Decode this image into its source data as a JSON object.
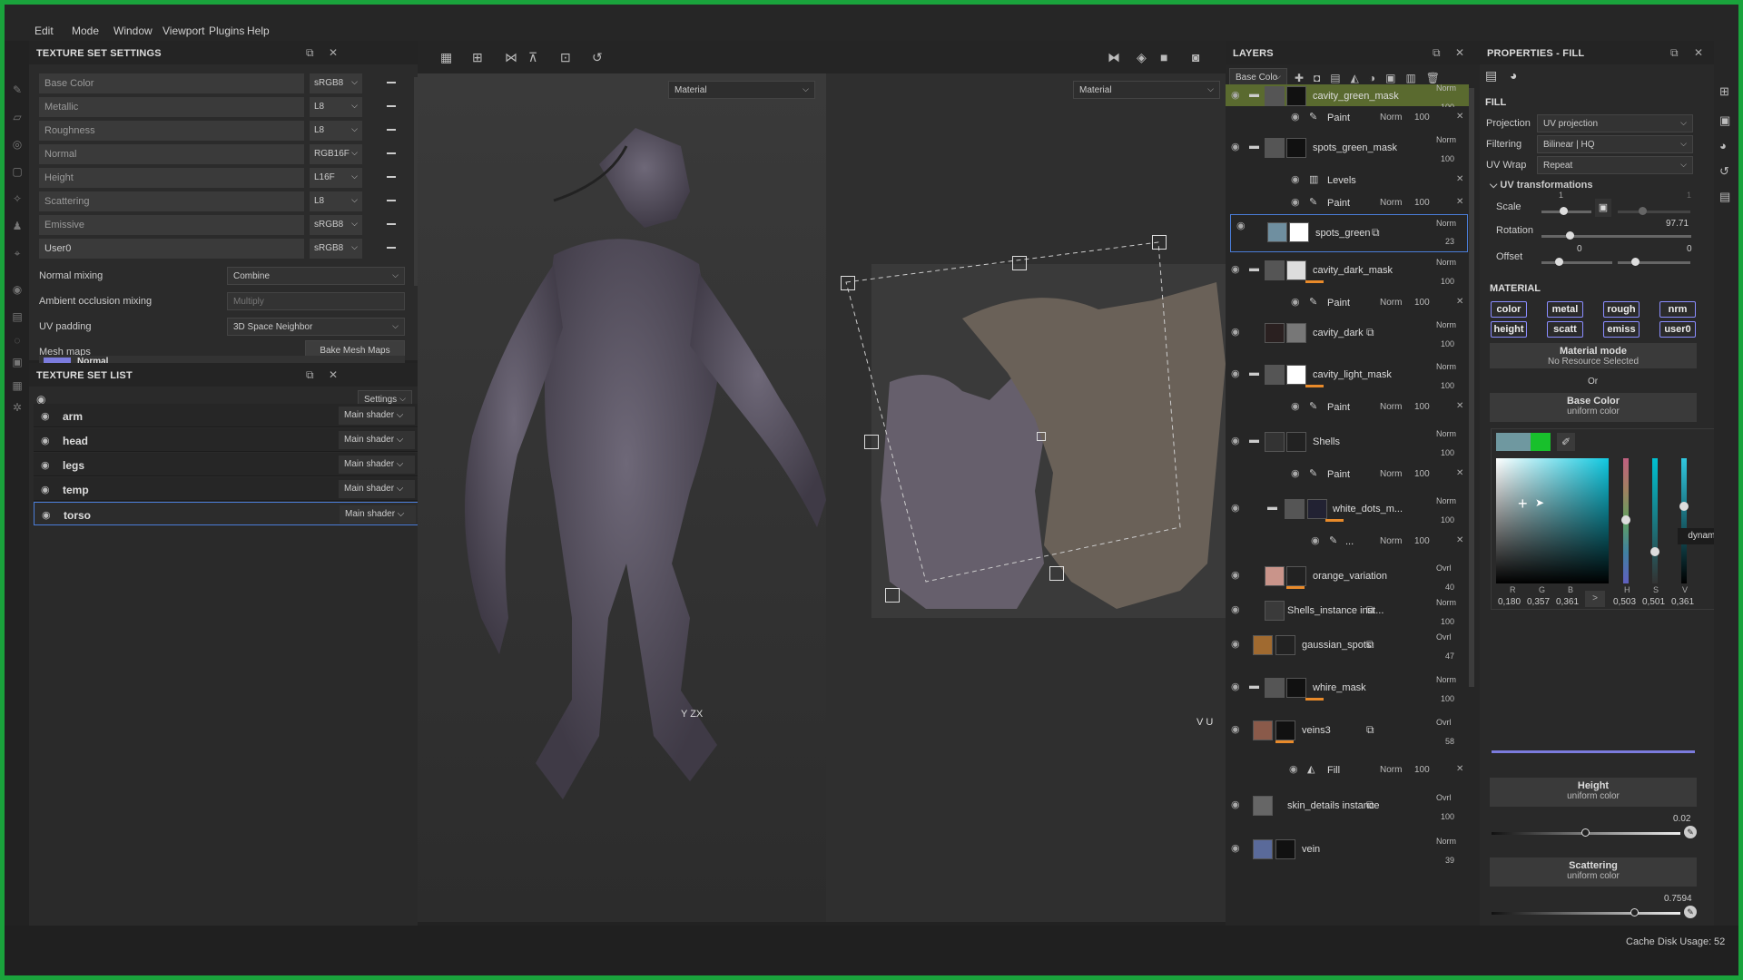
{
  "menu": [
    "Edit",
    "Mode",
    "Window",
    "Viewport",
    "Plugins",
    "Help"
  ],
  "texture_set_settings": {
    "title": "TEXTURE SET SETTINGS",
    "channels": [
      {
        "label": "Base Color",
        "format": "sRGB8"
      },
      {
        "label": "Metallic",
        "format": "L8"
      },
      {
        "label": "Roughness",
        "format": "L8"
      },
      {
        "label": "Normal",
        "format": "RGB16F"
      },
      {
        "label": "Height",
        "format": "L16F"
      },
      {
        "label": "Scattering",
        "format": "L8"
      },
      {
        "label": "Emissive",
        "format": "sRGB8"
      },
      {
        "label": "User0",
        "format": "sRGB8"
      }
    ],
    "normal_mixing_label": "Normal mixing",
    "normal_mixing": "Combine",
    "ao_mixing_label": "Ambient occlusion mixing",
    "ao_mixing": "Multiply",
    "uv_padding_label": "UV padding",
    "uv_padding": "3D Space Neighbor",
    "mesh_maps_label": "Mesh maps",
    "bake_button": "Bake Mesh Maps",
    "mesh_map_first": "Normal"
  },
  "texture_set_list": {
    "title": "TEXTURE SET LIST",
    "settings": "Settings",
    "items": [
      {
        "name": "arm",
        "shader": "Main shader"
      },
      {
        "name": "head",
        "shader": "Main shader"
      },
      {
        "name": "legs",
        "shader": "Main shader"
      },
      {
        "name": "temp",
        "shader": "Main shader"
      },
      {
        "name": "torso",
        "shader": "Main shader"
      }
    ]
  },
  "viewport": {
    "left_mode": "Material",
    "right_mode": "Material",
    "axis_3d": "Y ZX",
    "axis_uv": "V U"
  },
  "layers": {
    "title": "LAYERS",
    "channel": "Base Colo",
    "items": [
      {
        "name": "cavity_green_mask",
        "blend": "Norm",
        "opacity": "100"
      },
      {
        "name": "Paint",
        "blend": "Norm",
        "opacity": "100"
      },
      {
        "name": "spots_green_mask",
        "blend": "Norm",
        "opacity": "100"
      },
      {
        "name": "Levels"
      },
      {
        "name": "Paint",
        "blend": "Norm",
        "opacity": "100"
      },
      {
        "name": "spots_green",
        "blend": "Norm",
        "opacity": "23"
      },
      {
        "name": "cavity_dark_mask",
        "blend": "Norm",
        "opacity": "100"
      },
      {
        "name": "Paint",
        "blend": "Norm",
        "opacity": "100"
      },
      {
        "name": "cavity_dark",
        "blend": "Norm",
        "opacity": "100"
      },
      {
        "name": "cavity_light_mask",
        "blend": "Norm",
        "opacity": "100"
      },
      {
        "name": "Paint",
        "blend": "Norm",
        "opacity": "100"
      },
      {
        "name": "Shells",
        "blend": "Norm",
        "opacity": "100"
      },
      {
        "name": "Paint",
        "blend": "Norm",
        "opacity": "100"
      },
      {
        "name": "white_dots_m...",
        "blend": "Norm",
        "opacity": "100"
      },
      {
        "name": "...",
        "blend": "Norm",
        "opacity": "100"
      },
      {
        "name": "orange_variation",
        "blend": "Ovrl",
        "opacity": "40"
      },
      {
        "name": "Shells_instance inst...",
        "blend": "Norm",
        "opacity": "100"
      },
      {
        "name": "gaussian_spots",
        "blend": "Ovrl",
        "opacity": "47"
      },
      {
        "name": "whire_mask",
        "blend": "Norm",
        "opacity": "100"
      },
      {
        "name": "veins3",
        "blend": "Ovrl",
        "opacity": "58"
      },
      {
        "name": "Fill",
        "blend": "Norm",
        "opacity": "100"
      },
      {
        "name": "skin_details instance",
        "blend": "Ovrl",
        "opacity": "100"
      },
      {
        "name": "vein",
        "blend": "Norm",
        "opacity": "39"
      }
    ]
  },
  "properties": {
    "title": "PROPERTIES - FILL",
    "section_fill": "FILL",
    "projection_label": "Projection",
    "projection": "UV projection",
    "filtering_label": "Filtering",
    "filtering": "Bilinear | HQ",
    "uvwrap_label": "UV Wrap",
    "uvwrap": "Repeat",
    "uv_transform": "UV transformations",
    "scale_label": "Scale",
    "scale_a": "1",
    "scale_b": "1",
    "rotation_label": "Rotation",
    "rotation": "97.71",
    "offset_label": "Offset",
    "offset_a": "0",
    "offset_b": "0",
    "section_material": "MATERIAL",
    "chips": [
      "color",
      "metal",
      "rough",
      "nrm",
      "height",
      "scatt",
      "emiss",
      "user0"
    ],
    "material_mode": "Material mode",
    "no_resource": "No Resource Selected",
    "or": "Or",
    "base_color": "Base Color",
    "uniform_color": "uniform color",
    "dynamic": "dynamic",
    "rgb_labels": [
      "R",
      "G",
      "B"
    ],
    "rgb_values": [
      "0,180",
      "0,357",
      "0,361"
    ],
    "hsv_labels": [
      "H",
      "S",
      "V"
    ],
    "hsv_values": [
      "0,503",
      "0,501",
      "0,361"
    ],
    "height": "Height",
    "height_value": "0.02",
    "scattering": "Scattering",
    "scattering_value": "0.7594",
    "cache": "Cache Disk Usage:",
    "cache_value": "52"
  },
  "colors": {
    "accent": "#1aa33c",
    "select": "#4a7dd8",
    "chip_border": "#8a8cff",
    "picked": "#2e5b5c"
  }
}
